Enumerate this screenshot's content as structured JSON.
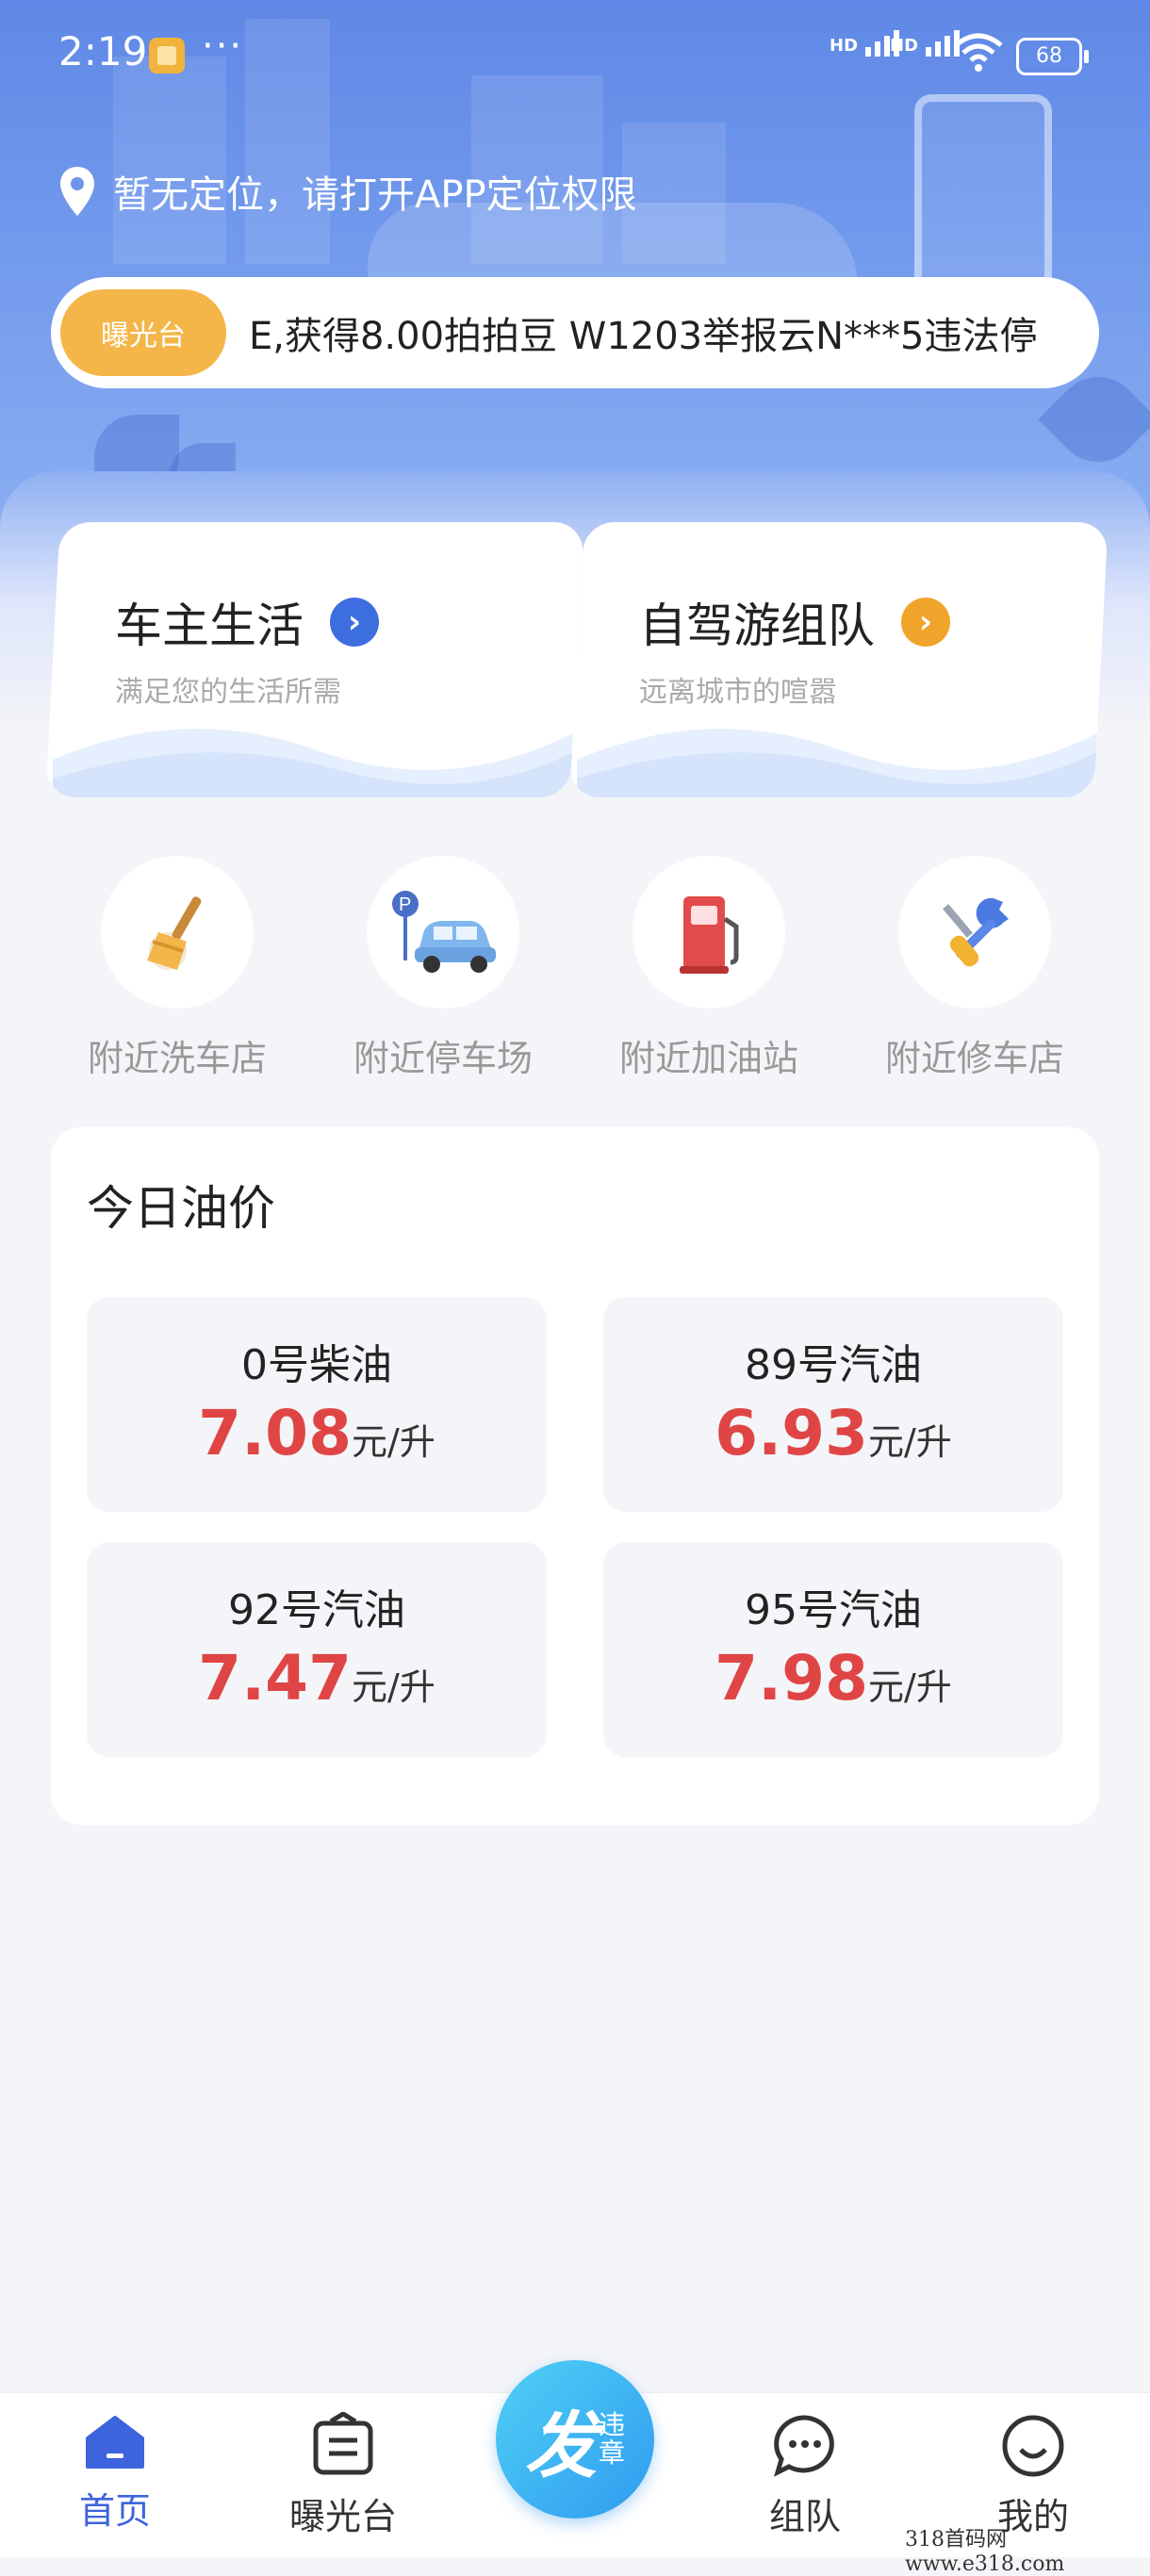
{
  "status_bar": {
    "time": "2:19",
    "more": "···",
    "sim1": "HD",
    "sim2": "HD",
    "battery": "68"
  },
  "location": {
    "text": "暂无定位，请打开APP定位权限"
  },
  "ticker": {
    "tag": "曝光台",
    "message": "E,获得8.00拍拍豆   W1203举报云N***5违法停"
  },
  "cards": [
    {
      "title": "车主生活",
      "subtitle": "满足您的生活所需",
      "accent": "#3d6ee0"
    },
    {
      "title": "自驾游组队",
      "subtitle": "远离城市的喧嚣",
      "accent": "#f1a42b"
    }
  ],
  "shortcuts": [
    {
      "label": "附近洗车店",
      "icon": "broom-icon"
    },
    {
      "label": "附近停车场",
      "icon": "parking-car-icon"
    },
    {
      "label": "附近加油站",
      "icon": "gas-pump-icon"
    },
    {
      "label": "附近修车店",
      "icon": "repair-tools-icon"
    }
  ],
  "oil": {
    "title": "今日油价",
    "items": [
      {
        "name": "0号柴油",
        "price": "7.08",
        "unit": "元/升"
      },
      {
        "name": "89号汽油",
        "price": "6.93",
        "unit": "元/升"
      },
      {
        "name": "92号汽油",
        "price": "7.47",
        "unit": "元/升"
      },
      {
        "name": "95号汽油",
        "price": "7.98",
        "unit": "元/升"
      }
    ]
  },
  "tabbar": {
    "home": "首页",
    "exposure": "曝光台",
    "fab_big": "发",
    "fab_small_1": "违",
    "fab_small_2": "章",
    "team": "组队",
    "mine": "我的"
  },
  "colors": {
    "accent": "#3d63dd",
    "price": "#e04545",
    "tag": "#f4b649"
  },
  "watermark": "318首码网  www.e318.com"
}
